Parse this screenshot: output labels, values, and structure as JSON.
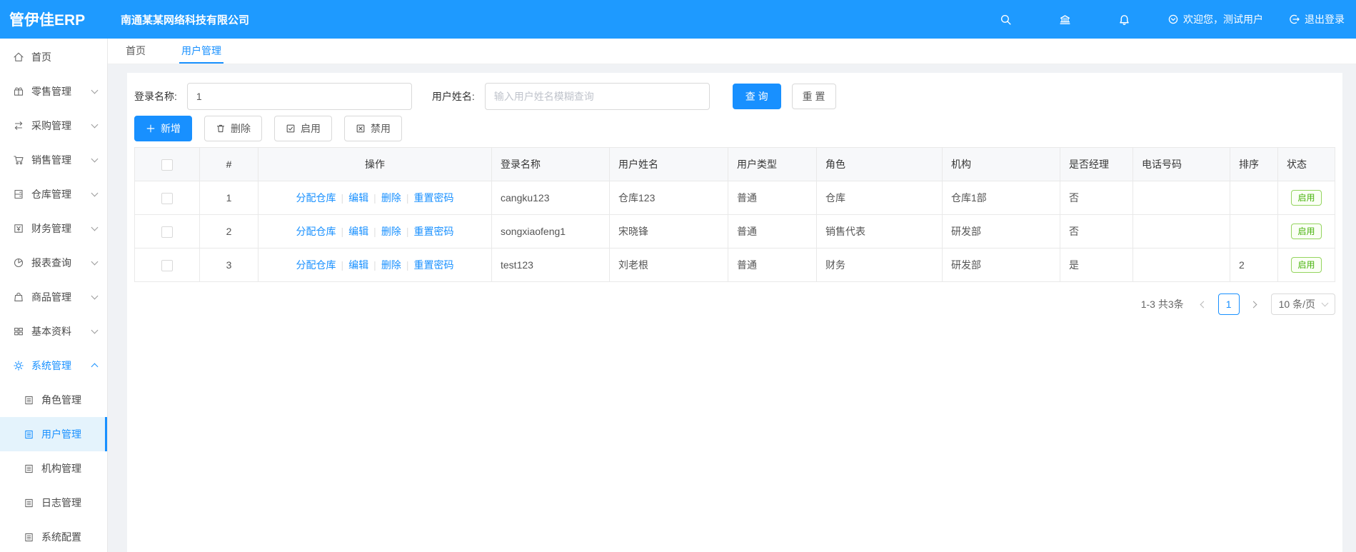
{
  "header": {
    "logo": "管伊佳ERP",
    "company": "南通某某网络科技有限公司",
    "welcome": "欢迎您，测试用户",
    "logout": "退出登录"
  },
  "icons": {
    "header": [
      "search-icon",
      "bank-icon",
      "bell-icon",
      "down-circle-icon",
      "logout-icon"
    ],
    "toolbar": [
      "plus-icon",
      "trash-icon",
      "check-square-icon",
      "x-square-icon"
    ]
  },
  "sidebar": {
    "items": [
      {
        "label": "首页"
      },
      {
        "label": "零售管理"
      },
      {
        "label": "采购管理"
      },
      {
        "label": "销售管理"
      },
      {
        "label": "仓库管理"
      },
      {
        "label": "财务管理"
      },
      {
        "label": "报表查询"
      },
      {
        "label": "商品管理"
      },
      {
        "label": "基本资料"
      },
      {
        "label": "系统管理"
      }
    ],
    "sub_items": [
      {
        "label": "角色管理"
      },
      {
        "label": "用户管理"
      },
      {
        "label": "机构管理"
      },
      {
        "label": "日志管理"
      },
      {
        "label": "系统配置"
      }
    ]
  },
  "tabs": [
    {
      "label": "首页"
    },
    {
      "label": "用户管理"
    }
  ],
  "filter": {
    "login_name_label": "登录名称:",
    "login_name_value": "1",
    "user_name_label": "用户姓名:",
    "user_name_placeholder": "输入用户姓名模糊查询",
    "search_button": "查 询",
    "reset_button": "重 置"
  },
  "toolbar": {
    "add": "新增",
    "delete": "删除",
    "enable": "启用",
    "disable": "禁用"
  },
  "table": {
    "columns": [
      "#",
      "操作",
      "登录名称",
      "用户姓名",
      "用户类型",
      "角色",
      "机构",
      "是否经理",
      "电话号码",
      "排序",
      "状态"
    ],
    "ops": [
      "分配仓库",
      "编辑",
      "删除",
      "重置密码"
    ],
    "rows": [
      {
        "index": "1",
        "login_name": "cangku123",
        "user_name": "仓库123",
        "user_type": "普通",
        "role": "仓库",
        "org": "仓库1部",
        "is_manager": "否",
        "phone": "",
        "sort": "",
        "status": "启用"
      },
      {
        "index": "2",
        "login_name": "songxiaofeng1",
        "user_name": "宋晓锋",
        "user_type": "普通",
        "role": "销售代表",
        "org": "研发部",
        "is_manager": "否",
        "phone": "",
        "sort": "",
        "status": "启用"
      },
      {
        "index": "3",
        "login_name": "test123",
        "user_name": "刘老根",
        "user_type": "普通",
        "role": "财务",
        "org": "研发部",
        "is_manager": "是",
        "phone": "",
        "sort": "2",
        "status": "启用"
      }
    ]
  },
  "pagination": {
    "total": "1-3 共3条",
    "current_page": "1",
    "page_size": "10 条/页"
  },
  "colors": {
    "header_bg": "#1e9aff",
    "primary": "#1890ff",
    "success": "#49b30e"
  }
}
